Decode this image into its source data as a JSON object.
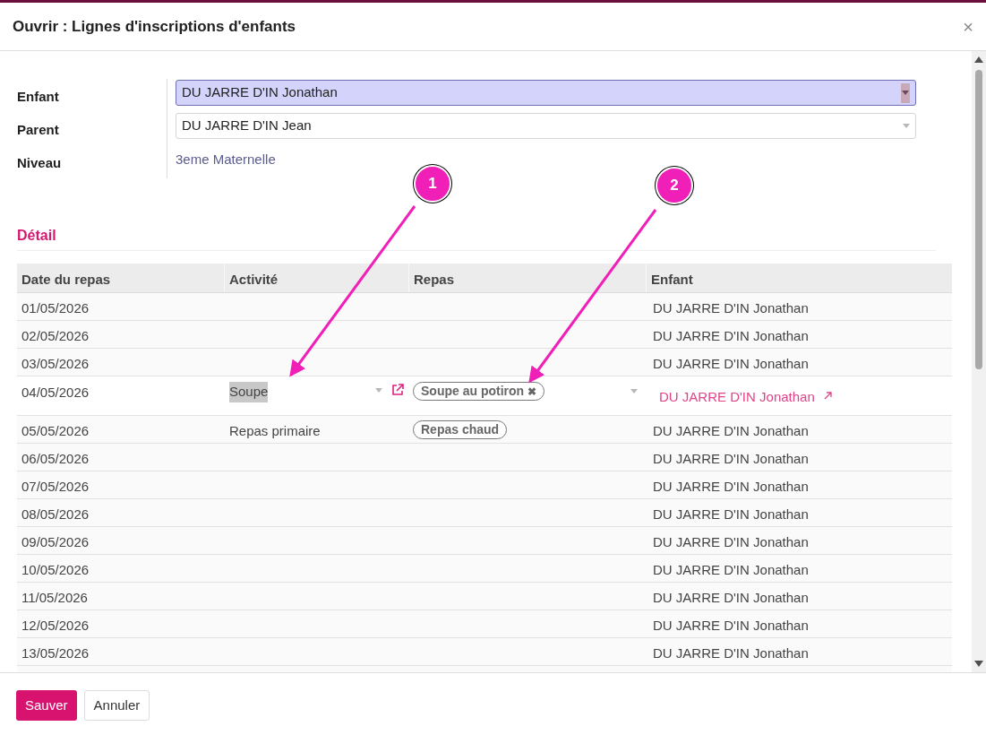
{
  "dialog": {
    "title": "Ouvrir : Lignes d'inscriptions d'enfants",
    "close": "×"
  },
  "form": {
    "fields": [
      {
        "label": "Enfant",
        "kind": "select",
        "value": "DU JARRE D'IN Jonathan",
        "focused": true
      },
      {
        "label": "Parent",
        "kind": "select",
        "value": "DU JARRE D'IN Jean",
        "focused": false
      },
      {
        "label": "Niveau",
        "kind": "readonly",
        "value": "3eme Maternelle"
      }
    ]
  },
  "section": {
    "title": "Détail"
  },
  "table": {
    "columns": [
      "Date du repas",
      "Activité",
      "Repas",
      "Enfant"
    ],
    "rows": [
      {
        "date": "01/05/2026",
        "activite": "",
        "repas": [],
        "enfant": "DU JARRE D'IN Jonathan",
        "editing": false
      },
      {
        "date": "02/05/2026",
        "activite": "",
        "repas": [],
        "enfant": "DU JARRE D'IN Jonathan",
        "editing": false
      },
      {
        "date": "03/05/2026",
        "activite": "",
        "repas": [],
        "enfant": "DU JARRE D'IN Jonathan",
        "editing": false
      },
      {
        "date": "04/05/2026",
        "activite": "Soupe",
        "repas": [
          {
            "label": "Soupe au potiron",
            "remove": "✖"
          }
        ],
        "enfant": "DU JARRE D'IN Jonathan",
        "editing": true
      },
      {
        "date": "05/05/2026",
        "activite": "Repas primaire",
        "repas": [
          {
            "label": "Repas chaud"
          }
        ],
        "enfant": "DU JARRE D'IN Jonathan",
        "editing": false
      },
      {
        "date": "06/05/2026",
        "activite": "",
        "repas": [],
        "enfant": "DU JARRE D'IN Jonathan",
        "editing": false
      },
      {
        "date": "07/05/2026",
        "activite": "",
        "repas": [],
        "enfant": "DU JARRE D'IN Jonathan",
        "editing": false
      },
      {
        "date": "08/05/2026",
        "activite": "",
        "repas": [],
        "enfant": "DU JARRE D'IN Jonathan",
        "editing": false
      },
      {
        "date": "09/05/2026",
        "activite": "",
        "repas": [],
        "enfant": "DU JARRE D'IN Jonathan",
        "editing": false
      },
      {
        "date": "10/05/2026",
        "activite": "",
        "repas": [],
        "enfant": "DU JARRE D'IN Jonathan",
        "editing": false
      },
      {
        "date": "11/05/2026",
        "activite": "",
        "repas": [],
        "enfant": "DU JARRE D'IN Jonathan",
        "editing": false
      },
      {
        "date": "12/05/2026",
        "activite": "",
        "repas": [],
        "enfant": "DU JARRE D'IN Jonathan",
        "editing": false
      },
      {
        "date": "13/05/2026",
        "activite": "",
        "repas": [],
        "enfant": "DU JARRE D'IN Jonathan",
        "editing": false
      }
    ]
  },
  "annotations": [
    {
      "label": "1"
    },
    {
      "label": "2"
    }
  ],
  "footer": {
    "buttons": [
      {
        "label": "Sauver",
        "kind": "primary"
      },
      {
        "label": "Annuler",
        "kind": "secondary"
      }
    ]
  }
}
